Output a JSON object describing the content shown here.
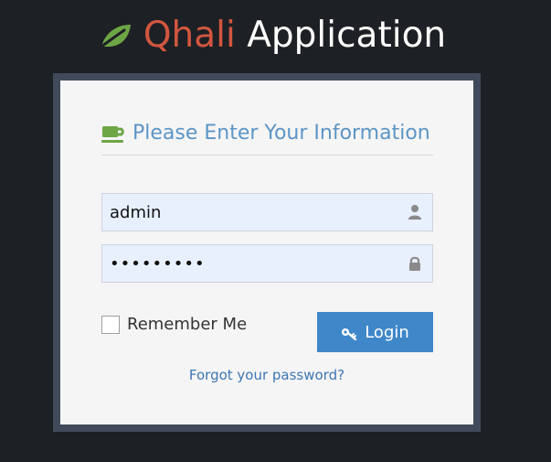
{
  "brand": {
    "accent": "Qhali",
    "main": " Application",
    "icon": "leaf-icon"
  },
  "login": {
    "title": "Please Enter Your Information",
    "title_icon": "coffee-cup-icon",
    "username_value": "admin",
    "password_value": "123456789",
    "username_icon": "user-icon",
    "password_icon": "lock-icon",
    "remember_label": "Remember Me",
    "button_label": "Login",
    "button_icon": "key-icon",
    "forgot_label": "Forgot your password?"
  },
  "colors": {
    "page_bg": "#1d2024",
    "frame_bg": "#414a5a",
    "card_bg": "#f5f5f5",
    "accent_red": "#d2563f",
    "title_blue": "#5c95c6",
    "button_blue": "#3f87c9",
    "link_blue": "#3d76b5",
    "leaf_green": "#6ea646"
  }
}
